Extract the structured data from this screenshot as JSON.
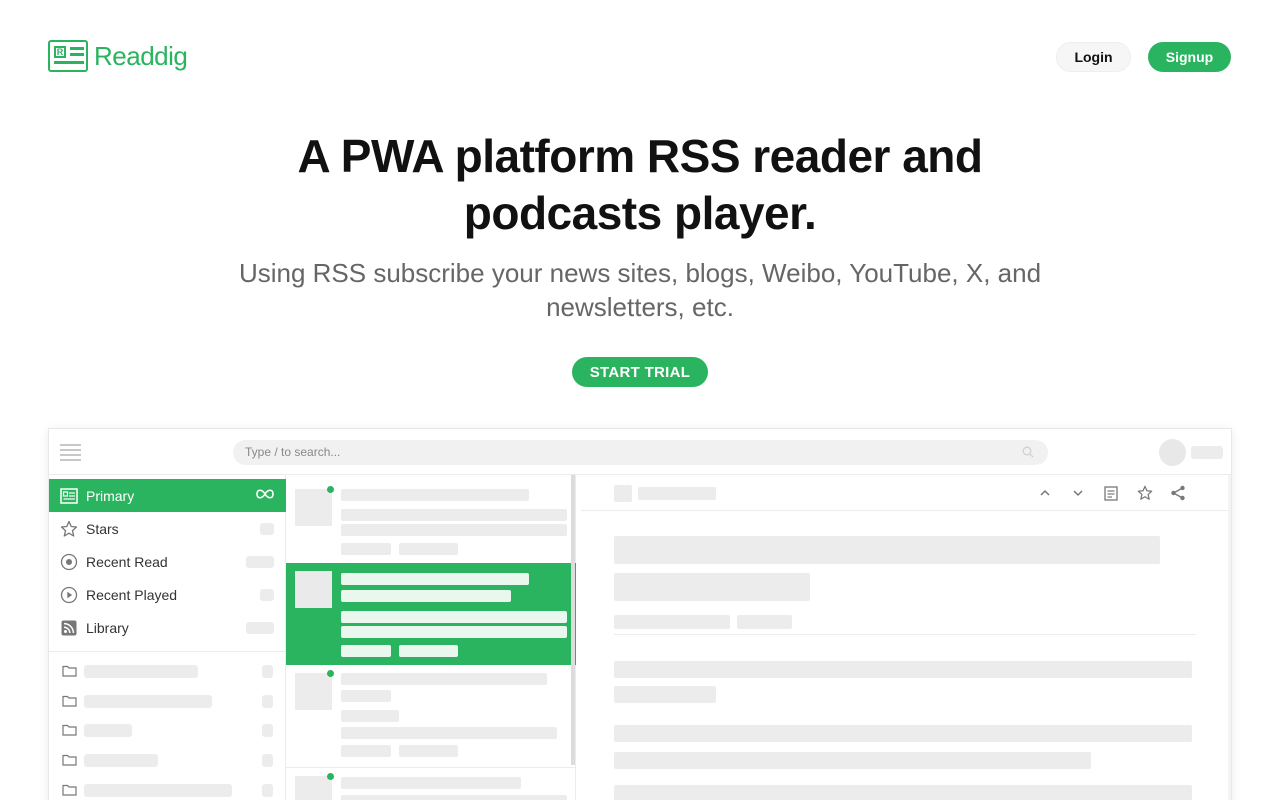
{
  "brand": {
    "name": "Readdig",
    "mark_letter": "R",
    "color": "#2bb45f"
  },
  "header": {
    "login_label": "Login",
    "signup_label": "Signup"
  },
  "hero": {
    "title": "A PWA platform RSS reader and podcasts player.",
    "subtitle": "Using RSS subscribe your news sites, blogs, Weibo, YouTube, X, and newsletters, etc.",
    "cta_label": "START TRIAL"
  },
  "app_preview": {
    "search": {
      "placeholder": "Type / to search..."
    },
    "sidebar": {
      "items": [
        {
          "label": "Primary",
          "icon": "feed-icon",
          "active": true
        },
        {
          "label": "Stars",
          "icon": "star-icon"
        },
        {
          "label": "Recent Read",
          "icon": "record-icon"
        },
        {
          "label": "Recent Played",
          "icon": "play-icon"
        },
        {
          "label": "Library",
          "icon": "rss-icon"
        }
      ],
      "folder_count": 5
    },
    "reader_toolbar": [
      "chevron-up-icon",
      "chevron-down-icon",
      "article-icon",
      "star-icon",
      "share-icon"
    ]
  }
}
